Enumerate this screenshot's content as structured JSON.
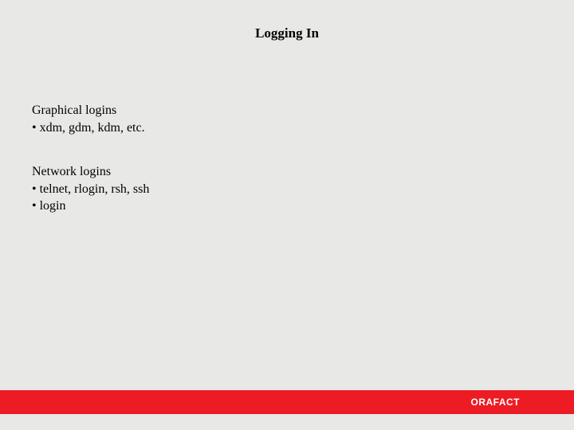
{
  "title": "Logging In",
  "sections": [
    {
      "heading": "Graphical logins",
      "bullets": [
        "xdm, gdm, kdm, etc."
      ]
    },
    {
      "heading": "Network logins",
      "bullets": [
        "telnet, rlogin, rsh, ssh",
        "login"
      ]
    }
  ],
  "footer": {
    "logo": "ORAFACT"
  }
}
